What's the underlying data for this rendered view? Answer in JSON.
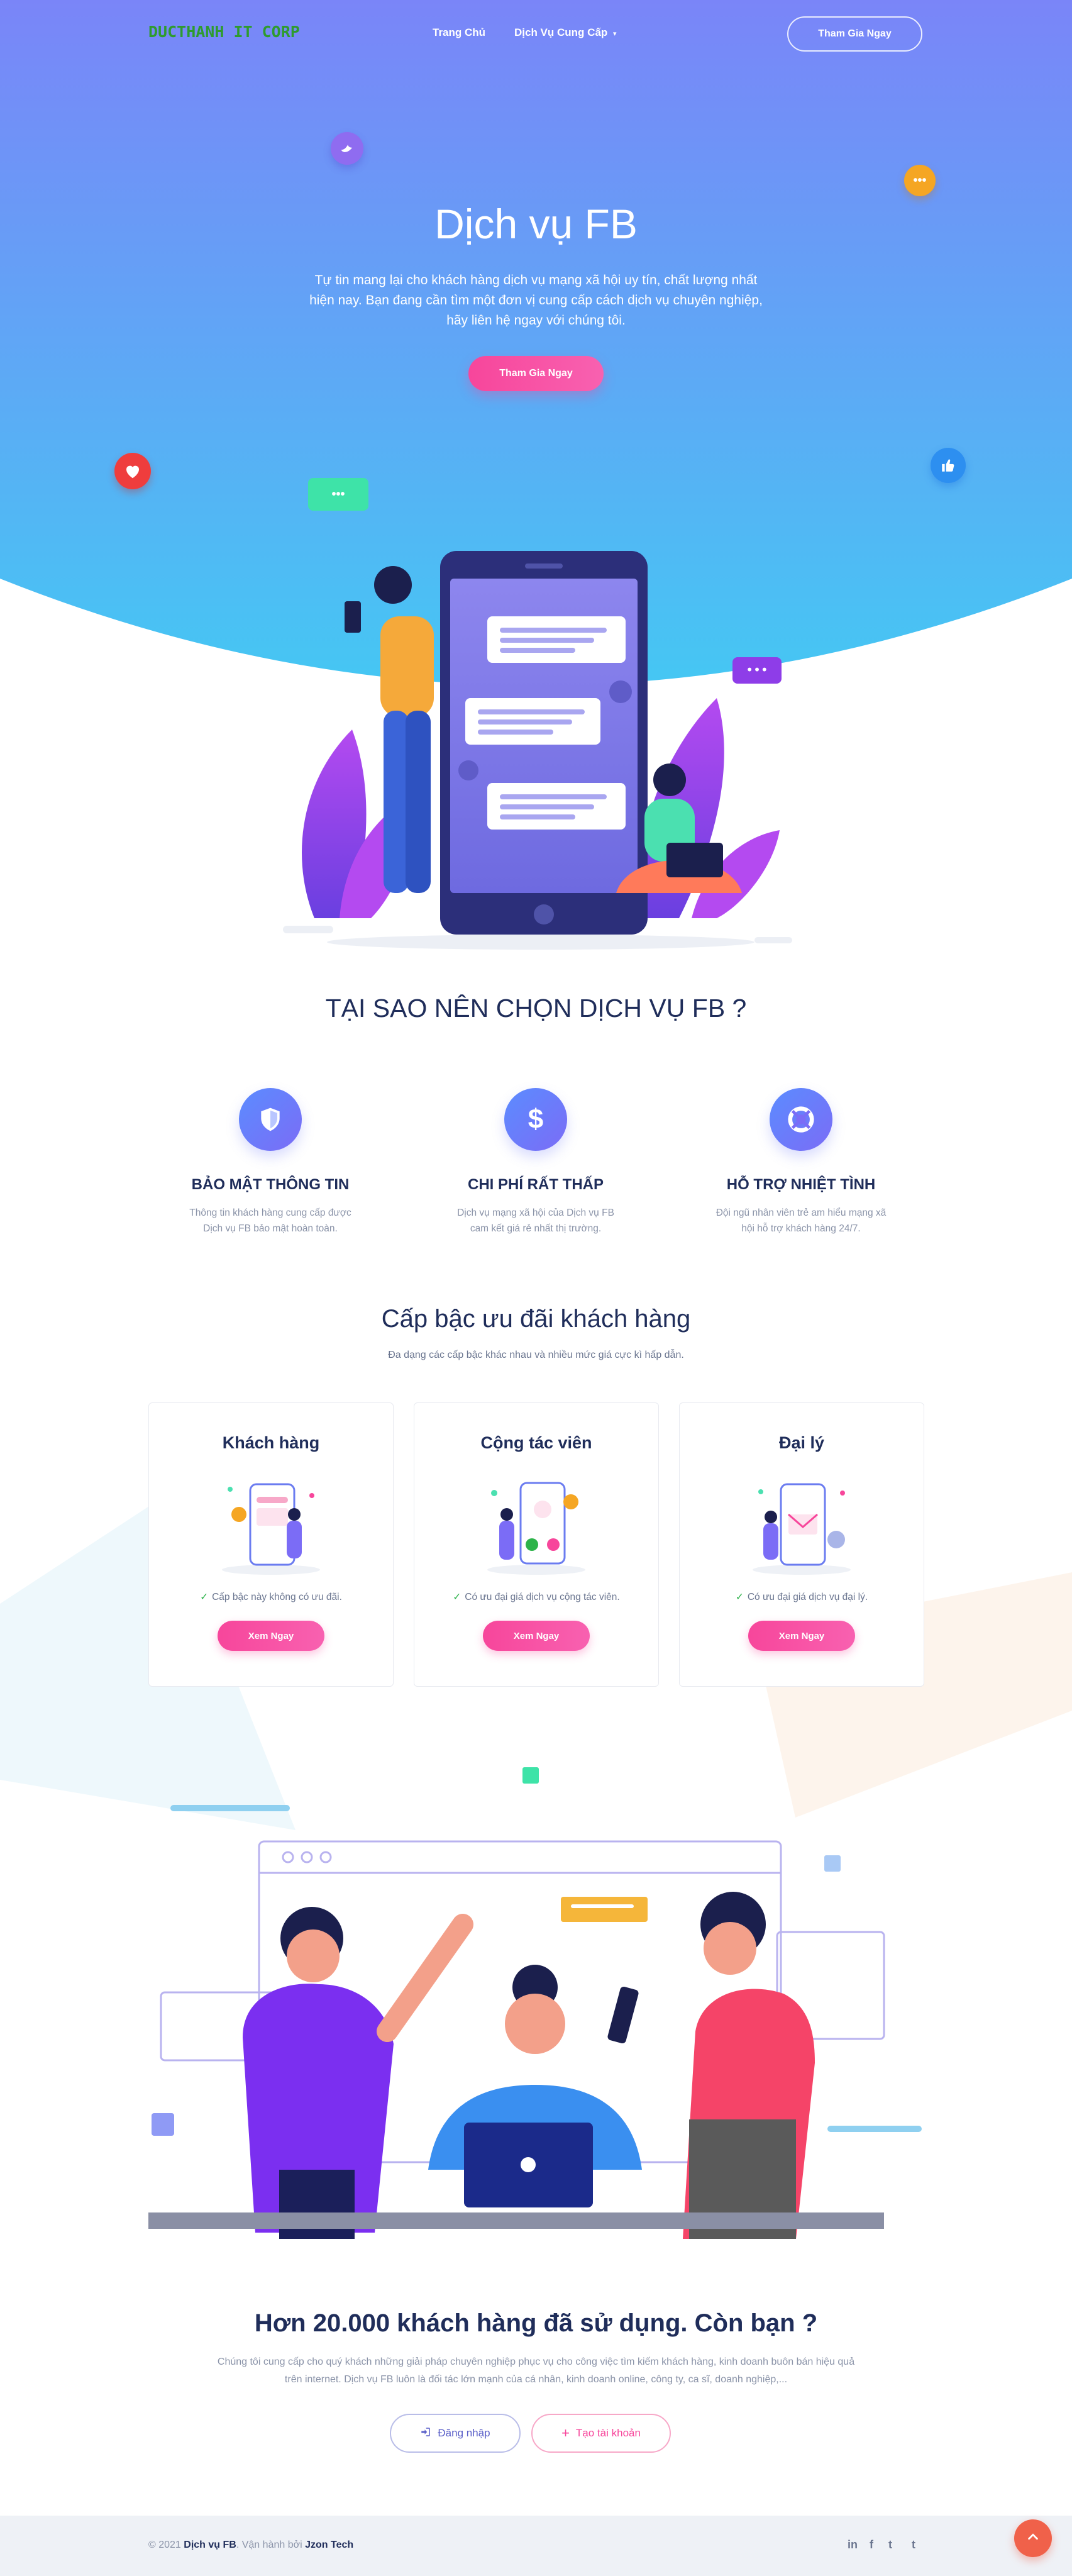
{
  "nav": {
    "logo": "DUCTHANH IT CORP",
    "home": "Trang Chủ",
    "services": "Dịch Vụ Cung Cấp",
    "cta": "Tham Gia Ngay"
  },
  "hero": {
    "title": "Dịch vụ FB",
    "description": "Tự tin mang lại cho khách hàng dịch vụ mạng xã hội uy tín, chất lượng nhất hiện nay. Bạn đang cần tìm một đơn vị cung cấp cách dịch vụ chuyên nghiệp, hãy liên hệ ngay với chúng tôi.",
    "cta": "Tham Gia Ngay"
  },
  "why": {
    "title": "TẠI SAO NÊN CHỌN DỊCH VỤ FB ?",
    "features": [
      {
        "icon": "shield-icon",
        "title": "BẢO MẬT THÔNG TIN",
        "text": "Thông tin khách hàng cung cấp được Dịch vụ FB bảo mật hoàn toàn."
      },
      {
        "icon": "dollar-icon",
        "title": "CHI PHÍ RẤT THẤP",
        "text": "Dịch vụ mạng xã hội của Dịch vụ FB cam kết giá rẻ nhất thị trường."
      },
      {
        "icon": "lifebuoy-icon",
        "title": "HỖ TRỢ NHIỆT TÌNH",
        "text": "Đội ngũ nhân viên trẻ am hiểu mạng xã hội hỗ trợ khách hàng 24/7."
      }
    ]
  },
  "tiers": {
    "title": "Cấp bậc ưu đãi khách hàng",
    "subtitle": "Đa dạng các cấp bậc khác nhau và nhiều mức giá cực kì hấp dẫn.",
    "cards": [
      {
        "name": "Khách hàng",
        "feature": "Cấp bậc này không có ưu đãi.",
        "button": "Xem Ngay"
      },
      {
        "name": "Cộng tác viên",
        "feature": "Có ưu đại giá dịch vụ cộng tác viên.",
        "button": "Xem Ngay"
      },
      {
        "name": "Đại lý",
        "feature": "Có ưu đại giá dịch vụ đại lý.",
        "button": "Xem Ngay"
      }
    ]
  },
  "cta": {
    "title": "Hơn 20.000 khách hàng đã sử dụng. Còn bạn ?",
    "description": "Chúng tôi cung cấp cho quý khách những giải pháp chuyên nghiệp phục vụ cho công việc tìm kiếm khách hàng, kinh doanh buôn bán hiệu quả trên internet. Dịch vụ FB luôn là đối tác lớn mạnh của cá nhân, kinh doanh online, công ty, ca sĩ, doanh nghiệp,...",
    "login": "Đăng nhập",
    "register": "Tạo tài khoản"
  },
  "footer": {
    "copyright": "© 2021",
    "brand": "Dịch vụ FB",
    "operated": ". Vận hành bởi",
    "operator": "Jzon Tech",
    "social": [
      "in",
      "f",
      "t",
      "t"
    ]
  },
  "colors": {
    "hero_top": "#7a85f8",
    "hero_bottom": "#45c7f3",
    "accent_pink": "#f7469b",
    "heading": "#1f2d5a",
    "check_green": "#2db34a"
  }
}
